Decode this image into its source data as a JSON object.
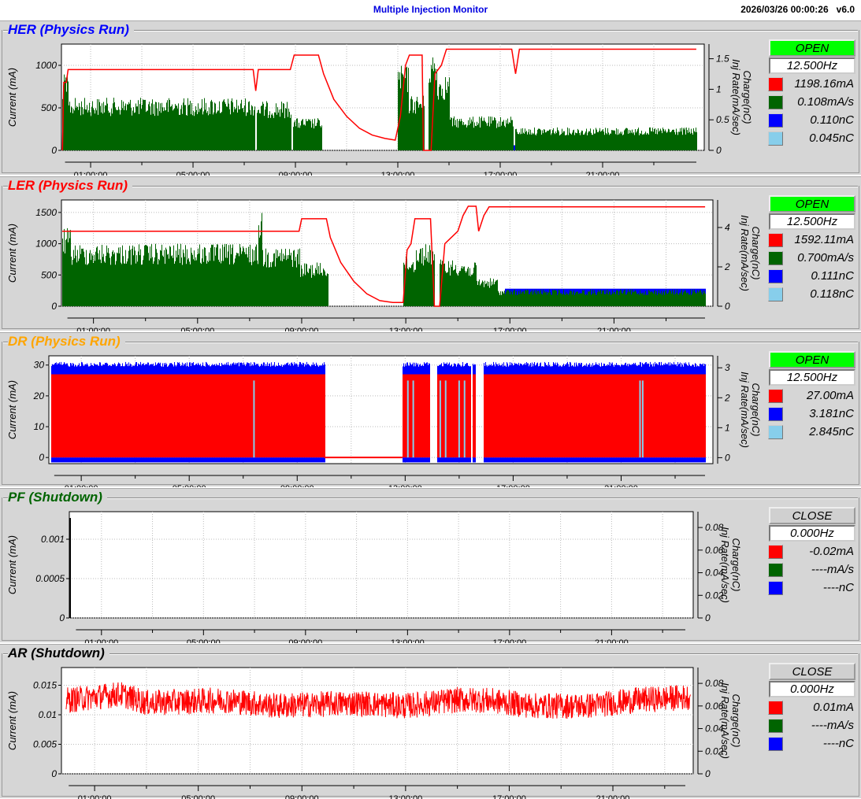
{
  "header": {
    "title": "Multiple Injection Monitor",
    "datetime": "2026/03/26 00:00:26",
    "version": "v6.0"
  },
  "axis_labels": {
    "left": "Current (mA)",
    "right_1": "Charge(nC)",
    "right_2": "Inj Rate(mA/sec)"
  },
  "time_ticks": [
    "01:00:00",
    "05:00:00",
    "09:00:00",
    "13:00:00",
    "17:00:00",
    "21:00:00"
  ],
  "colors": {
    "current": "#ff0000",
    "rate": "#006400",
    "charge": "#0000ff",
    "charge2": "#87ceeb",
    "open": "#00ff00",
    "close": "#d0d0d0"
  },
  "chart_data": [
    {
      "type": "line",
      "name": "HER",
      "title": "HER  (Physics Run)",
      "title_color": "#0000ff",
      "status": "OPEN",
      "freq": "12.500Hz",
      "legend": [
        {
          "color": "#ff0000",
          "value": "1198.16mA"
        },
        {
          "color": "#006400",
          "value": "0.108mA/s"
        },
        {
          "color": "#0000ff",
          "value": "0.110nC"
        },
        {
          "color": "#87ceeb",
          "value": "0.045nC"
        }
      ],
      "xlim": [
        -0.14,
        24.97
      ],
      "ylim": [
        0,
        1250
      ],
      "yticks": [
        "0",
        "500",
        "1000"
      ],
      "ytick_values": [
        0,
        500,
        1000
      ],
      "y2lim": [
        0,
        1.74
      ],
      "y2ticks": [
        "0",
        "0.5",
        "1",
        "1.5"
      ],
      "y2tick_values": [
        0,
        0.5,
        1,
        1.5
      ],
      "rate_segments": [
        [
          -0.1,
          0.1,
          900
        ],
        [
          0.1,
          7.4,
          620
        ],
        [
          7.5,
          8.8,
          580
        ],
        [
          8.9,
          10,
          380
        ],
        [
          13,
          13.4,
          1000
        ],
        [
          13.4,
          14,
          650
        ],
        [
          14.2,
          14.5,
          1150
        ],
        [
          14.5,
          15,
          900
        ],
        [
          15,
          17.5,
          400
        ],
        [
          17.6,
          24.66,
          270
        ]
      ],
      "charge_segments": [
        [
          -0.1,
          0.1,
          60
        ],
        [
          13,
          14,
          60
        ],
        [
          14.2,
          14.5,
          60
        ],
        [
          17.5,
          17.6,
          60
        ]
      ],
      "current": [
        [
          -0.1,
          0
        ],
        [
          -0.05,
          800
        ],
        [
          0.05,
          800
        ],
        [
          0.12,
          950
        ],
        [
          7.35,
          950
        ],
        [
          7.45,
          700
        ],
        [
          7.55,
          950
        ],
        [
          8.8,
          950
        ],
        [
          8.95,
          1120
        ],
        [
          9.9,
          1120
        ],
        [
          10.1,
          900
        ],
        [
          10.5,
          600
        ],
        [
          11,
          400
        ],
        [
          11.5,
          260
        ],
        [
          12,
          180
        ],
        [
          12.5,
          140
        ],
        [
          12.9,
          120
        ],
        [
          13.1,
          400
        ],
        [
          13.3,
          1000
        ],
        [
          13.45,
          1120
        ],
        [
          13.95,
          1120
        ],
        [
          14.0,
          0
        ],
        [
          14.3,
          0
        ],
        [
          14.45,
          900
        ],
        [
          14.7,
          1000
        ],
        [
          14.9,
          1190
        ],
        [
          17.45,
          1190
        ],
        [
          17.6,
          900
        ],
        [
          17.75,
          1190
        ],
        [
          24.66,
          1190
        ]
      ]
    },
    {
      "type": "line",
      "name": "LER",
      "title": "LER  (Physics Run)",
      "title_color": "#ff0000",
      "status": "OPEN",
      "freq": "12.500Hz",
      "legend": [
        {
          "color": "#ff0000",
          "value": "1592.11mA"
        },
        {
          "color": "#006400",
          "value": "0.700mA/s"
        },
        {
          "color": "#0000ff",
          "value": "0.111nC"
        },
        {
          "color": "#87ceeb",
          "value": "0.118nC"
        }
      ],
      "xlim": [
        -0.23,
        24.8
      ],
      "ylim": [
        0,
        1700
      ],
      "yticks": [
        "0",
        "500",
        "1000",
        "1500"
      ],
      "ytick_values": [
        0,
        500,
        1000,
        1500
      ],
      "y2lim": [
        0,
        5.4
      ],
      "y2ticks": [
        "0",
        "2",
        "4"
      ],
      "y2tick_values": [
        0,
        2,
        4
      ],
      "rate_segments": [
        [
          -0.2,
          0.1,
          1250
        ],
        [
          0.1,
          7.3,
          1000
        ],
        [
          7.35,
          7.45,
          1600
        ],
        [
          7.5,
          8.9,
          950
        ],
        [
          8.9,
          10,
          700
        ],
        [
          12.9,
          13.4,
          800
        ],
        [
          13.4,
          14.1,
          1000
        ],
        [
          14.3,
          15.2,
          750
        ],
        [
          15.2,
          15.7,
          700
        ],
        [
          15.7,
          16.5,
          450
        ],
        [
          16.5,
          24.5,
          270
        ]
      ],
      "charge_segments": [
        [
          12.9,
          13.1,
          200
        ],
        [
          14.3,
          14.5,
          200
        ],
        [
          15.6,
          16,
          200
        ],
        [
          16.8,
          24.5,
          280
        ]
      ],
      "current": [
        [
          -0.2,
          1200
        ],
        [
          8.9,
          1200
        ],
        [
          9.0,
          1400
        ],
        [
          9.95,
          1400
        ],
        [
          10.1,
          1100
        ],
        [
          10.5,
          700
        ],
        [
          11,
          400
        ],
        [
          11.5,
          200
        ],
        [
          12,
          90
        ],
        [
          12.5,
          60
        ],
        [
          12.9,
          60
        ],
        [
          13.05,
          900
        ],
        [
          13.2,
          1000
        ],
        [
          13.35,
          1400
        ],
        [
          13.95,
          1400
        ],
        [
          14.1,
          0
        ],
        [
          14.3,
          0
        ],
        [
          14.5,
          1000
        ],
        [
          15.0,
          1200
        ],
        [
          15.2,
          1450
        ],
        [
          15.4,
          1600
        ],
        [
          15.7,
          1600
        ],
        [
          15.8,
          1200
        ],
        [
          16.0,
          1450
        ],
        [
          16.2,
          1590
        ],
        [
          24.5,
          1590
        ]
      ]
    },
    {
      "type": "area",
      "name": "DR",
      "title": "DR  (Physics Run)",
      "title_color": "#ffa500",
      "status": "OPEN",
      "freq": "12.500Hz",
      "legend": [
        {
          "color": "#ff0000",
          "value": "27.00mA"
        },
        {
          "color": "#0000ff",
          "value": "3.181nC"
        },
        {
          "color": "#87ceeb",
          "value": "2.845nC"
        }
      ],
      "xlim": [
        -0.2,
        24.4
      ],
      "ylim": [
        -2,
        33
      ],
      "yticks": [
        "0",
        "10",
        "20",
        "30"
      ],
      "ytick_values": [
        0,
        10,
        20,
        30
      ],
      "y2lim": [
        -0.2,
        3.4
      ],
      "y2ticks": [
        "0",
        "1",
        "2",
        "3"
      ],
      "y2tick_values": [
        0,
        1,
        2,
        3
      ],
      "current_segments": [
        [
          -0.1,
          10,
          27
        ],
        [
          12.9,
          13.9,
          27
        ],
        [
          14.2,
          15.4,
          27
        ],
        [
          15.5,
          15.6,
          27
        ],
        [
          15.9,
          24.1,
          27
        ]
      ],
      "charge_segments": [
        [
          -0.1,
          10,
          31
        ],
        [
          12.9,
          13.9,
          31
        ],
        [
          14.2,
          15.4,
          31
        ],
        [
          15.5,
          15.6,
          31
        ],
        [
          15.9,
          24.1,
          31
        ]
      ],
      "current": [
        [
          10,
          0
        ],
        [
          12.9,
          0
        ]
      ]
    },
    {
      "type": "line",
      "name": "PF",
      "title": "PF  (Shutdown)",
      "title_color": "#006400",
      "status": "CLOSE",
      "freq": "0.000Hz",
      "legend": [
        {
          "color": "#ff0000",
          "value": "-0.02mA"
        },
        {
          "color": "#006400",
          "value": "----mA/s"
        },
        {
          "color": "#0000ff",
          "value": "----nC"
        }
      ],
      "xlim": [
        -0.26,
        24.2
      ],
      "ylim": [
        0,
        0.00135
      ],
      "yticks": [
        "0",
        "0.0005",
        "0.001"
      ],
      "ytick_values": [
        0,
        0.0005,
        0.001
      ],
      "y2lim": [
        0,
        0.094
      ],
      "y2ticks": [
        "0",
        "0.02",
        "0.04",
        "0.06",
        "0.08"
      ],
      "y2tick_values": [
        0,
        0.02,
        0.04,
        0.06,
        0.08
      ],
      "current": []
    },
    {
      "type": "line",
      "name": "AR",
      "title": "AR  (Shutdown)",
      "title_color": "#000000",
      "status": "CLOSE",
      "freq": "0.000Hz",
      "legend": [
        {
          "color": "#ff0000",
          "value": "0.01mA"
        },
        {
          "color": "#006400",
          "value": "----mA/s"
        },
        {
          "color": "#0000ff",
          "value": "----nC"
        }
      ],
      "xlim": [
        -0.28,
        24.1
      ],
      "ylim": [
        0,
        0.018
      ],
      "yticks": [
        "0",
        "0.005",
        "0.01",
        "0.015"
      ],
      "ytick_values": [
        0,
        0.005,
        0.01,
        0.015
      ],
      "y2lim": [
        0,
        0.094
      ],
      "y2ticks": [
        "0",
        "0.02",
        "0.04",
        "0.06",
        "0.08"
      ],
      "y2tick_values": [
        0,
        0.02,
        0.04,
        0.06,
        0.08
      ],
      "noisy_current": {
        "from": -0.1,
        "to": 24.0,
        "points": [
          [
            0,
            0.0125
          ],
          [
            2,
            0.0135
          ],
          [
            3,
            0.012
          ],
          [
            6,
            0.0125
          ],
          [
            8,
            0.0115
          ],
          [
            11,
            0.012
          ],
          [
            13,
            0.0115
          ],
          [
            15,
            0.0125
          ],
          [
            16,
            0.0125
          ],
          [
            18,
            0.0115
          ],
          [
            20,
            0.0115
          ],
          [
            22,
            0.0125
          ],
          [
            24,
            0.013
          ]
        ],
        "amplitude": 0.0022
      },
      "current": []
    }
  ]
}
